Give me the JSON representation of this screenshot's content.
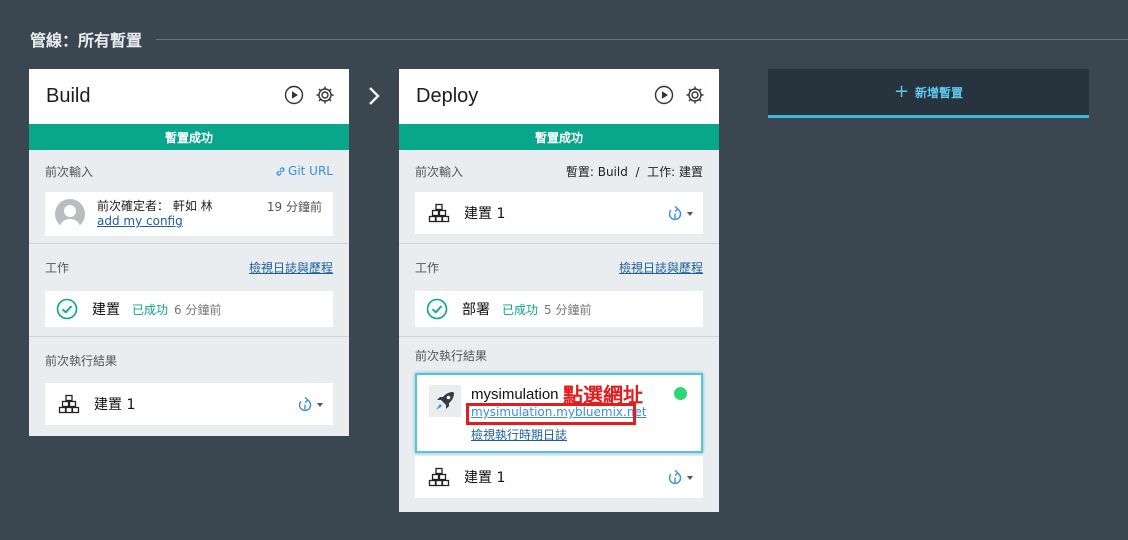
{
  "pipeline": {
    "title": "管線：所有暫置"
  },
  "build": {
    "name": "Build",
    "status": "暫置成功",
    "input": {
      "label": "前次輸入",
      "link": "Git URL",
      "author": "前次確定者： 軒如 林",
      "message": "add my config",
      "time": "19 分鐘前"
    },
    "jobs": {
      "label": "工作",
      "link": "檢視日誌與歷程",
      "job": {
        "name": "建置",
        "status": "已成功",
        "time": "6 分鐘前"
      }
    },
    "results": {
      "label": "前次執行結果",
      "artifact": "建置 1"
    }
  },
  "deploy": {
    "name": "Deploy",
    "status": "暫置成功",
    "input": {
      "label": "前次輸入",
      "source": "暫置: Build  /  工作: 建置",
      "artifact": "建置 1"
    },
    "jobs": {
      "label": "工作",
      "link": "檢視日誌與歷程",
      "job": {
        "name": "部署",
        "status": "已成功",
        "time": "5 分鐘前"
      }
    },
    "results": {
      "label": "前次執行結果",
      "app": {
        "name": "mysimulation",
        "url": "mysimulation.mybluemix.net",
        "logs": "檢視執行時期日誌",
        "annotation": "點選網址"
      },
      "artifact": "建置 1"
    }
  },
  "add_stage": {
    "label": "新增暫置"
  },
  "colors": {
    "success": "#08a68a",
    "accent": "#3db9df",
    "annotation": "#e11d1d",
    "running": "#2ed678"
  },
  "icons": [
    "play-icon",
    "gear-icon",
    "link-icon",
    "check-circle-icon",
    "artifact-icon",
    "redeploy-icon",
    "chevron-right-icon",
    "rocket-icon",
    "plus-icon"
  ]
}
